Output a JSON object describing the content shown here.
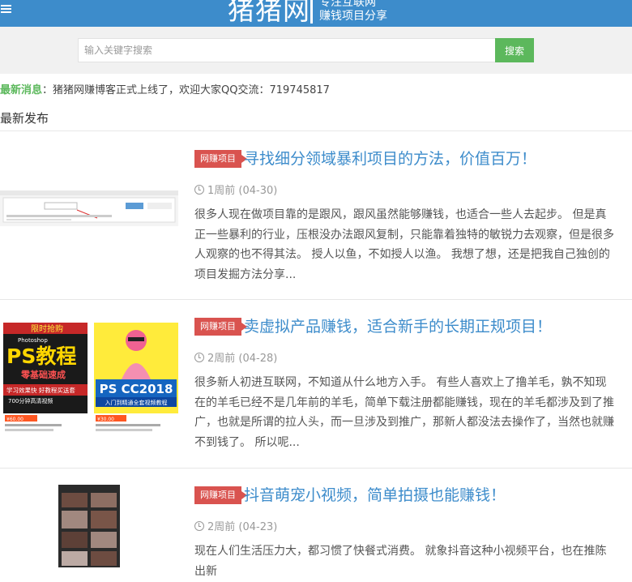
{
  "header": {
    "logo": "猪猪网",
    "slogan_line1": "专注互联网",
    "slogan_line2": "赚钱项目分享",
    "menu_icon": "menu-icon"
  },
  "search": {
    "placeholder": "输入关键字搜索",
    "button_label": "搜索"
  },
  "news": {
    "label": "最新消息",
    "text": "：猪猪网赚博客正式上线了，欢迎大家QQ交流：719745817"
  },
  "section": {
    "title": "最新发布"
  },
  "colors": {
    "header_bg": "#3d8ccb",
    "link": "#3d8ccb",
    "accent_green": "#5cb85c",
    "tag_red": "#d9534f"
  },
  "articles": [
    {
      "tag": "网赚项目",
      "title": "寻找细分领域暴利项目的方法，价值百万！",
      "time": "1周前 (04-30)",
      "excerpt": "很多人现在做项目靠的是跟风，跟风虽然能够赚钱，也适合一些人去起步。 但是真正一些暴利的行业，压根没办法跟风复制，只能靠着独特的敏锐力去观察，但是很多人观察的也不得其法。 授人以鱼，不如授人以渔。 我想了想，还是把我自己独创的项目发掘方法分享..."
    },
    {
      "tag": "网赚项目",
      "title": "卖虚拟产品赚钱，适合新手的长期正规项目！",
      "time": "2周前 (04-28)",
      "excerpt": "很多新人初进互联网，不知道从什么地方入手。 有些人喜欢上了撸羊毛，孰不知现在的羊毛已经不是几年前的羊毛，简单下载注册都能赚钱，现在的羊毛都涉及到了推广，也就是所谓的拉人头，而一旦涉及到推广，那新人都没法去操作了，当然也就赚不到钱了。 所以呢...",
      "thumb_text": {
        "left_header": "限时抢购",
        "left_sub": "Photoshop",
        "left_big": "PS教程",
        "left_mid": "零基础速成",
        "left_banner": "学习效果快 好教程买送套",
        "left_banner2": "700分钟高清视频",
        "right_big": "PS CC2018",
        "right_sub": "入门到精通全套视频教程",
        "left_price": "¥60.00",
        "right_price": "¥30.00"
      }
    },
    {
      "tag": "网赚项目",
      "title": "抖音萌宠小视频，简单拍摄也能赚钱！",
      "time": "2周前 (04-23)",
      "excerpt": "现在人们生活压力大，都习惯了快餐式消费。 就象抖音这种小视频平台，也在推陈出新"
    }
  ]
}
